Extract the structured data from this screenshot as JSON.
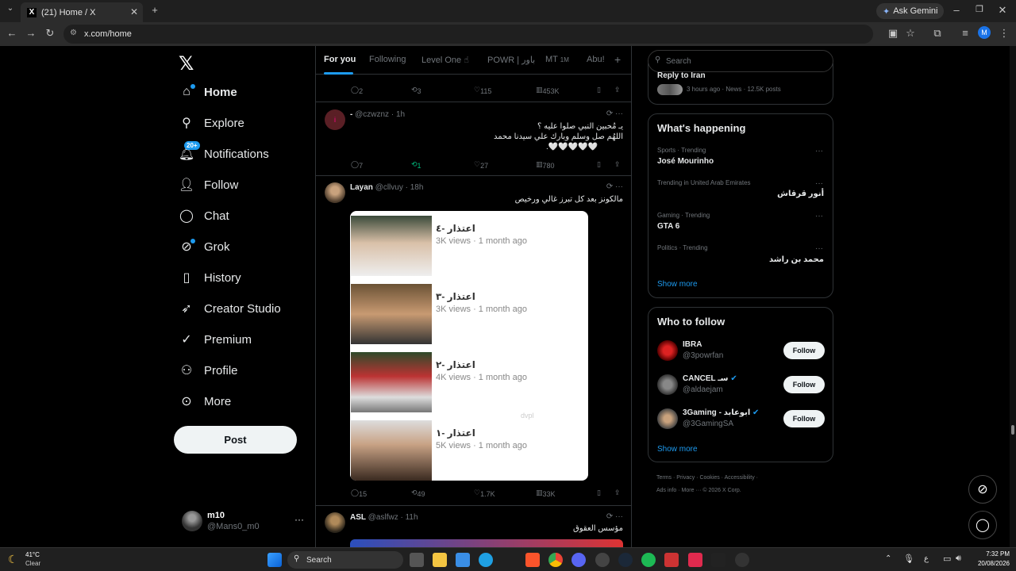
{
  "browser": {
    "tab_title": "(21) Home / X",
    "url": "x.com/home",
    "gemini_label": "Ask Gemini",
    "profile_initial": "M"
  },
  "nav": {
    "items": [
      {
        "label": "Home",
        "icon": "home-icon"
      },
      {
        "label": "Explore",
        "icon": "search-icon"
      },
      {
        "label": "Notifications",
        "icon": "bell-icon",
        "badge": "20+"
      },
      {
        "label": "Follow",
        "icon": "add-person-icon"
      },
      {
        "label": "Chat",
        "icon": "chat-icon"
      },
      {
        "label": "Grok",
        "icon": "grok-icon"
      },
      {
        "label": "History",
        "icon": "bookmark-icon"
      },
      {
        "label": "Creator Studio",
        "icon": "rocket-icon"
      },
      {
        "label": "Premium",
        "icon": "verified-icon"
      },
      {
        "label": "Profile",
        "icon": "person-icon"
      },
      {
        "label": "More",
        "icon": "more-circle-icon"
      }
    ],
    "post_label": "Post",
    "account": {
      "name": "m10",
      "handle": "@Mans0_m0",
      "more": "···"
    }
  },
  "timeline": {
    "tabs": [
      "For you",
      "Following",
      "Level One ☝",
      "POWR | باور",
      "MT",
      "Abu!"
    ],
    "mt_count": "1M",
    "top_actions": {
      "replies": "2",
      "reposts": "3",
      "likes": "115",
      "views": "453K"
    },
    "tweet1": {
      "name": "-",
      "handle": "@czwznz · 1h",
      "lines": [
        "يـ مُحبين النبي صلوا عليه ؟",
        "اللهُم صل وسلم وبارك علي سيدنا محمد",
        "🤍🤍🤍🤍🤍."
      ],
      "actions": {
        "replies": "7",
        "reposts": "1",
        "likes": "27",
        "views": "780"
      }
    },
    "tweet2": {
      "name": "Layan",
      "handle": "@cllvuy · 18h",
      "text": "مالكونز بعد كل تبرز غالي ورخيص",
      "videos": [
        {
          "title": "اعتذار -٤",
          "meta": "3K views · 1 month ago"
        },
        {
          "title": "اعتذار -٣",
          "meta": "3K views · 1 month ago"
        },
        {
          "title": "اعتذار -٢",
          "meta": "4K views · 1 month ago"
        },
        {
          "title": "اعتذار -١",
          "meta": "5K views · 1 month ago"
        }
      ],
      "watermark": "dvpl",
      "actions": {
        "replies": "15",
        "reposts": "49",
        "likes": "1.7K",
        "views": "33K"
      }
    },
    "tweet3": {
      "name": "ASL",
      "handle": "@aslfwz · 11h",
      "text": "مؤسس العقوق"
    }
  },
  "right": {
    "search_placeholder": "Search",
    "news_item": {
      "title": "Reply to Iran",
      "meta": "3 hours ago · News · 12.5K posts"
    },
    "happening_title": "What's happening",
    "trends": [
      {
        "category": "Sports · Trending",
        "name": "José Mourinho"
      },
      {
        "category": "Trending in United Arab Emirates",
        "name": "أنور قرقاش"
      },
      {
        "category": "Gaming · Trending",
        "name": "GTA 6"
      },
      {
        "category": "Politics · Trending",
        "name": "محمد بن راشد"
      }
    ],
    "show_more": "Show more",
    "wtf_title": "Who to follow",
    "follow_label": "Follow",
    "suggestions": [
      {
        "name": "IBRA",
        "handle": "@3powrfan"
      },
      {
        "name": "CANCEL ‏سـ",
        "handle": "@aldaejam"
      },
      {
        "name": "3Gaming - ابوعابد",
        "handle": "@3GamingSA"
      }
    ],
    "footer_line1": "Terms · Privacy · Cookies · Accessibility ·",
    "footer_line2": "Ads info · More ··· © 2026 X Corp."
  },
  "taskbar": {
    "weather_temp": "41°C",
    "weather_desc": "Clear",
    "search_label": "Search",
    "time": "7:32 PM",
    "date": "20/08/2026"
  }
}
